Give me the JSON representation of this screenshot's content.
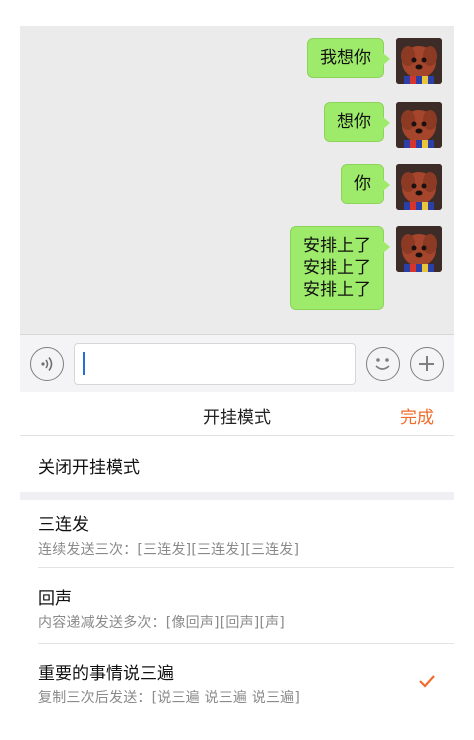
{
  "chat": {
    "messages": [
      {
        "text": "我想你"
      },
      {
        "text": "想你"
      },
      {
        "text": "你"
      },
      {
        "text": "安排上了\n安排上了\n安排上了"
      }
    ]
  },
  "input": {
    "value": ""
  },
  "sheet": {
    "title": "开挂模式",
    "done_label": "完成",
    "options": [
      {
        "title": "关闭开挂模式",
        "subtitle": ""
      },
      {
        "title": "三连发",
        "subtitle": "连续发送三次：[三连发][三连发][三连发]"
      },
      {
        "title": "回声",
        "subtitle": "内容递减发送多次：[像回声][回声][声]"
      },
      {
        "title": "重要的事情说三遍",
        "subtitle": "复制三次后发送：[说三遍 说三遍 说三遍]",
        "selected": true
      }
    ]
  },
  "colors": {
    "bubble": "#9eea6a",
    "accent": "#f26b2a",
    "caret": "#2d6bd6"
  }
}
